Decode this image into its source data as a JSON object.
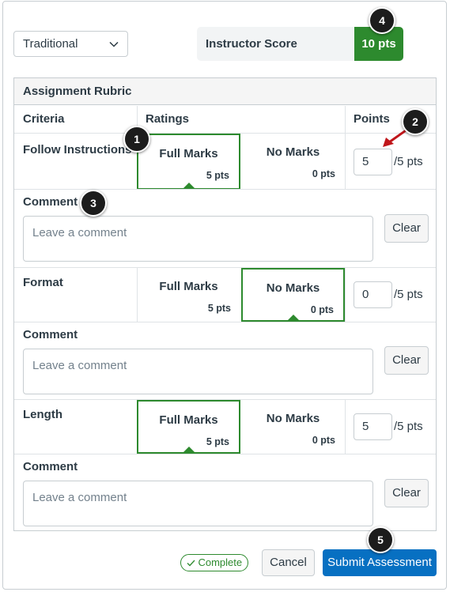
{
  "header": {
    "view_select": "Traditional",
    "score_label": "Instructor Score",
    "score_value": "10 pts"
  },
  "rubric": {
    "title": "Assignment Rubric",
    "columns": {
      "criteria": "Criteria",
      "ratings": "Ratings",
      "points": "Points"
    },
    "criteria": [
      {
        "name": "Follow Instructions",
        "ratings": [
          {
            "title": "Full Marks",
            "pts": "5 pts"
          },
          {
            "title": "No Marks",
            "pts": "0 pts"
          }
        ],
        "selected": 0,
        "points": "5",
        "max": "/5 pts",
        "comment_label": "Comment",
        "comment_placeholder": "Leave a comment",
        "clear_label": "Clear"
      },
      {
        "name": "Format",
        "ratings": [
          {
            "title": "Full Marks",
            "pts": "5 pts"
          },
          {
            "title": "No Marks",
            "pts": "0 pts"
          }
        ],
        "selected": 1,
        "points": "0",
        "max": "/5 pts",
        "comment_label": "Comment",
        "comment_placeholder": "Leave a comment",
        "clear_label": "Clear"
      },
      {
        "name": "Length",
        "ratings": [
          {
            "title": "Full Marks",
            "pts": "5 pts"
          },
          {
            "title": "No Marks",
            "pts": "0 pts"
          }
        ],
        "selected": 0,
        "points": "5",
        "max": "/5 pts",
        "comment_label": "Comment",
        "comment_placeholder": "Leave a comment",
        "clear_label": "Clear"
      }
    ]
  },
  "footer": {
    "complete_label": "Complete",
    "cancel_label": "Cancel",
    "submit_label": "Submit Assessment"
  },
  "callouts": [
    "1",
    "2",
    "3",
    "4",
    "5"
  ],
  "colors": {
    "selected": "#2d8a2e",
    "primary": "#0770c2",
    "arrow": "#c0161b"
  }
}
